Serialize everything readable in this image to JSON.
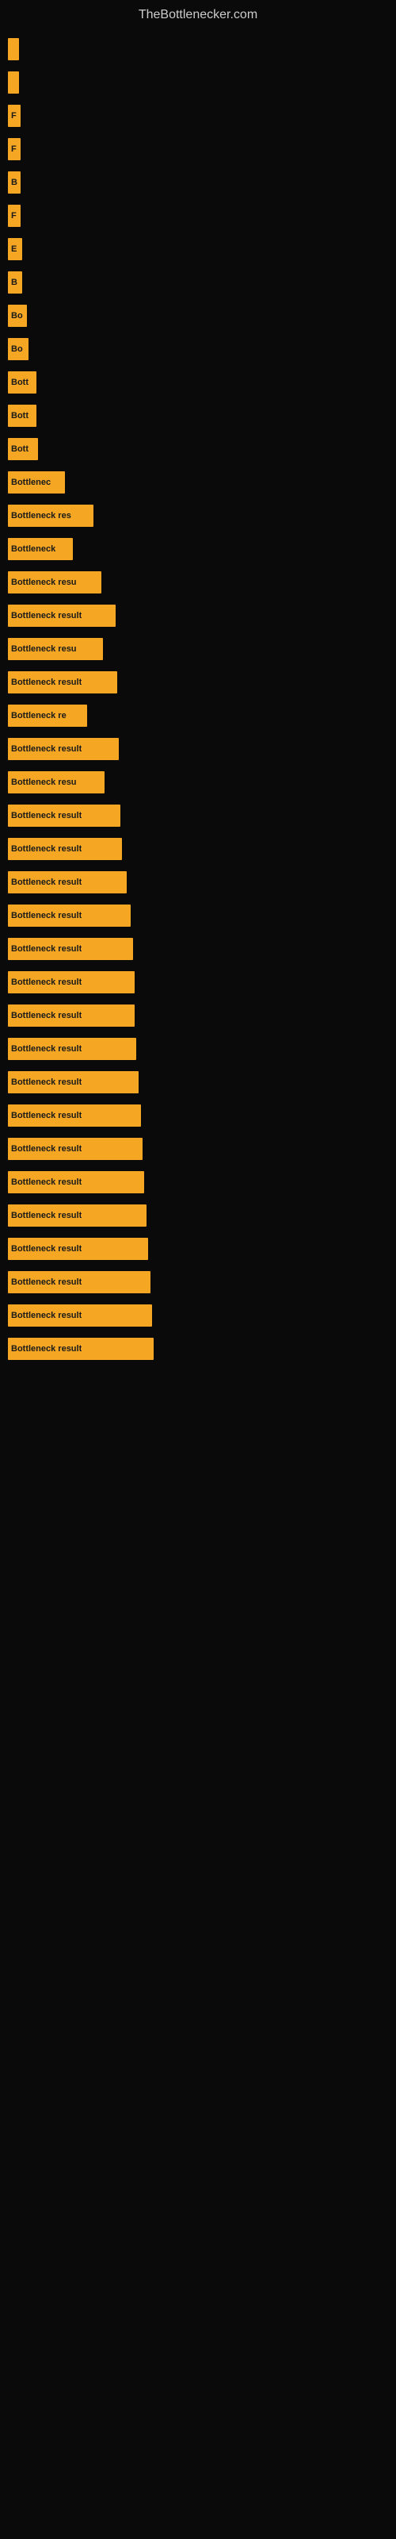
{
  "site": {
    "title": "TheBottlenecker.com"
  },
  "bars": [
    {
      "id": 1,
      "label": "",
      "width": 14
    },
    {
      "id": 2,
      "label": "",
      "width": 14
    },
    {
      "id": 3,
      "label": "F",
      "width": 16
    },
    {
      "id": 4,
      "label": "F",
      "width": 16
    },
    {
      "id": 5,
      "label": "B",
      "width": 16
    },
    {
      "id": 6,
      "label": "F",
      "width": 16
    },
    {
      "id": 7,
      "label": "E",
      "width": 18
    },
    {
      "id": 8,
      "label": "B",
      "width": 18
    },
    {
      "id": 9,
      "label": "Bo",
      "width": 24
    },
    {
      "id": 10,
      "label": "Bo",
      "width": 26
    },
    {
      "id": 11,
      "label": "Bott",
      "width": 36
    },
    {
      "id": 12,
      "label": "Bott",
      "width": 36
    },
    {
      "id": 13,
      "label": "Bott",
      "width": 38
    },
    {
      "id": 14,
      "label": "Bottlenec",
      "width": 72
    },
    {
      "id": 15,
      "label": "Bottleneck res",
      "width": 108
    },
    {
      "id": 16,
      "label": "Bottleneck",
      "width": 82
    },
    {
      "id": 17,
      "label": "Bottleneck resu",
      "width": 118
    },
    {
      "id": 18,
      "label": "Bottleneck result",
      "width": 136
    },
    {
      "id": 19,
      "label": "Bottleneck resu",
      "width": 120
    },
    {
      "id": 20,
      "label": "Bottleneck result",
      "width": 138
    },
    {
      "id": 21,
      "label": "Bottleneck re",
      "width": 100
    },
    {
      "id": 22,
      "label": "Bottleneck result",
      "width": 140
    },
    {
      "id": 23,
      "label": "Bottleneck resu",
      "width": 122
    },
    {
      "id": 24,
      "label": "Bottleneck result",
      "width": 142
    },
    {
      "id": 25,
      "label": "Bottleneck result",
      "width": 144
    },
    {
      "id": 26,
      "label": "Bottleneck result",
      "width": 150
    },
    {
      "id": 27,
      "label": "Bottleneck result",
      "width": 155
    },
    {
      "id": 28,
      "label": "Bottleneck result",
      "width": 158
    },
    {
      "id": 29,
      "label": "Bottleneck result",
      "width": 160
    },
    {
      "id": 30,
      "label": "Bottleneck result",
      "width": 160
    },
    {
      "id": 31,
      "label": "Bottleneck result",
      "width": 162
    },
    {
      "id": 32,
      "label": "Bottleneck result",
      "width": 165
    },
    {
      "id": 33,
      "label": "Bottleneck result",
      "width": 168
    },
    {
      "id": 34,
      "label": "Bottleneck result",
      "width": 170
    },
    {
      "id": 35,
      "label": "Bottleneck result",
      "width": 172
    },
    {
      "id": 36,
      "label": "Bottleneck result",
      "width": 175
    },
    {
      "id": 37,
      "label": "Bottleneck result",
      "width": 177
    },
    {
      "id": 38,
      "label": "Bottleneck result",
      "width": 180
    },
    {
      "id": 39,
      "label": "Bottleneck result",
      "width": 182
    },
    {
      "id": 40,
      "label": "Bottleneck result",
      "width": 184
    }
  ]
}
